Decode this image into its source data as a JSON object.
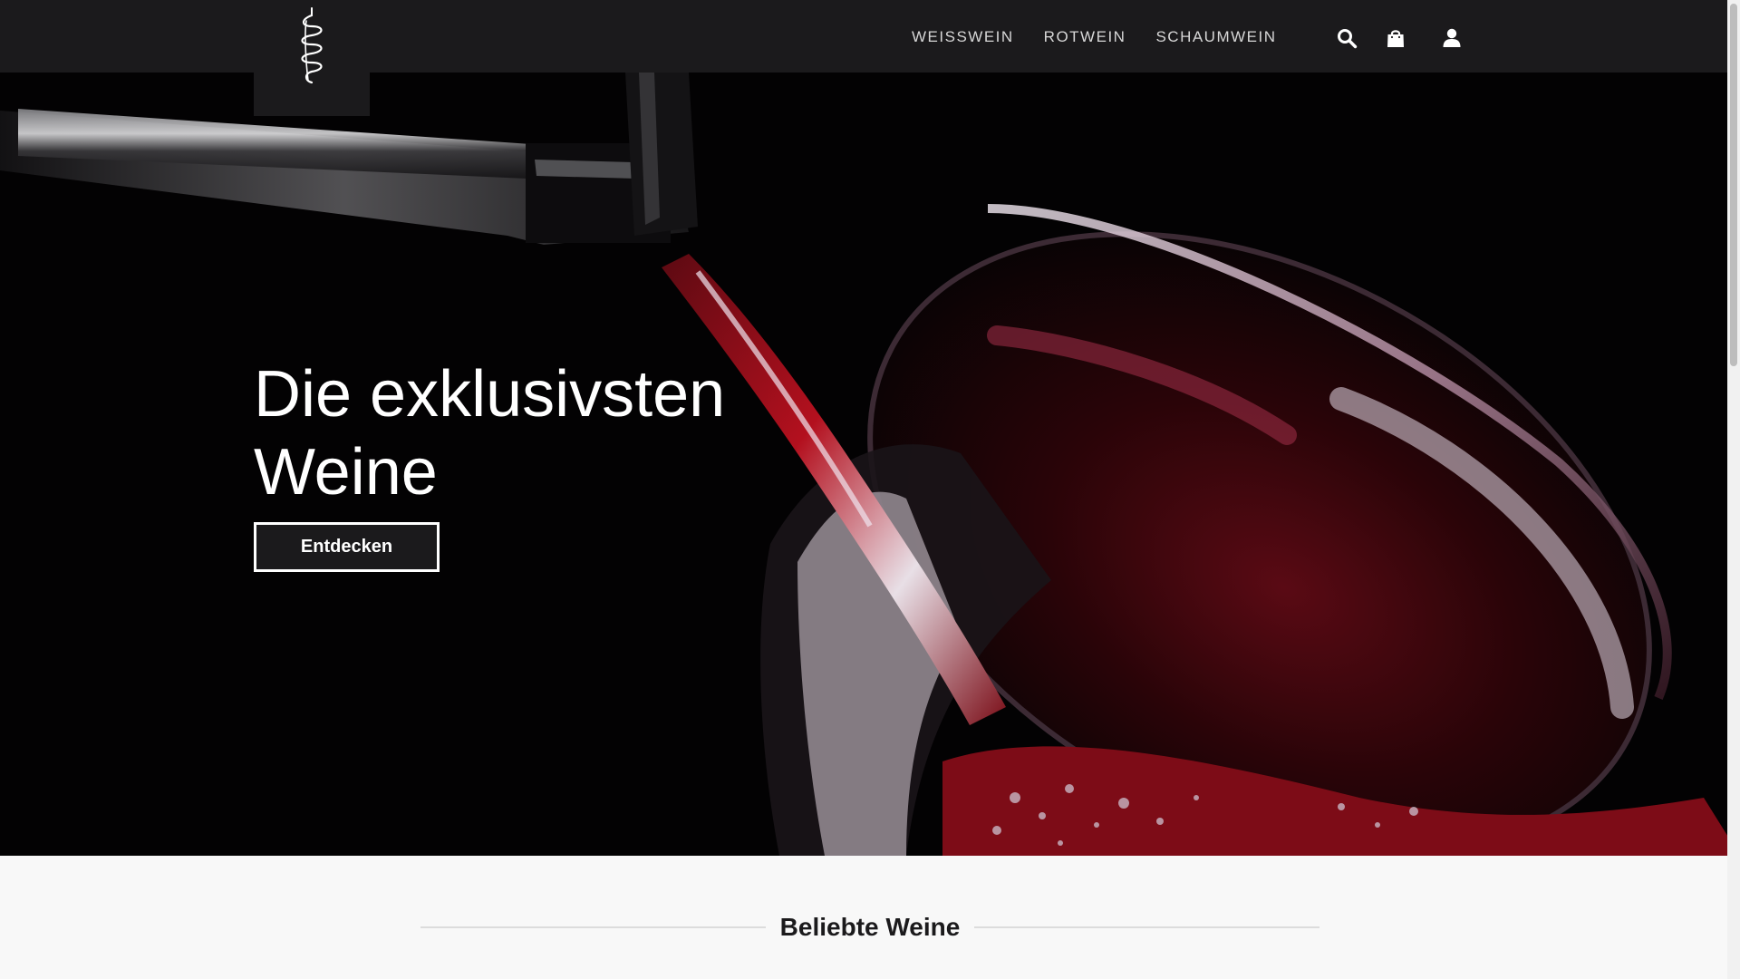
{
  "header": {
    "logo_alt": "Weinshop Logo",
    "nav": [
      {
        "label": "WEISSWEIN"
      },
      {
        "label": "ROTWEIN"
      },
      {
        "label": "SCHAUMWEIN"
      }
    ],
    "icons": [
      "search-icon",
      "shopping-bag-icon",
      "user-icon"
    ]
  },
  "hero": {
    "title_line1": "Die exklusivsten",
    "title_line2": "Weine",
    "cta_label": "Entdecken"
  },
  "section": {
    "heading": "Beliebte Weine"
  },
  "colors": {
    "header_bg": "#1b1a1c",
    "hero_bg": "#030203",
    "wine": "#8a0d18",
    "text_light": "#ffffff",
    "nav_text": "#d7d7d7",
    "page_bg": "#f8f8f8"
  }
}
